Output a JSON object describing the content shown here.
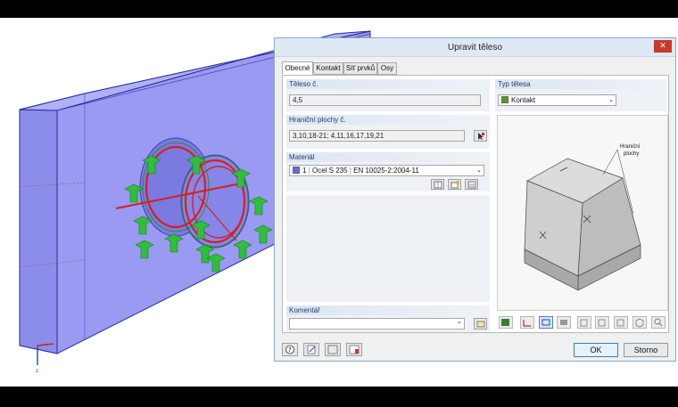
{
  "dialog": {
    "title": "Upravit těleso",
    "close_glyph": "✕"
  },
  "tabs": [
    {
      "label": "Obecné",
      "active": true
    },
    {
      "label": "Kontakt",
      "active": false
    },
    {
      "label": "Síť prvků",
      "active": false
    },
    {
      "label": "Osy",
      "active": false
    }
  ],
  "fields": {
    "body_no_label": "Těleso č.",
    "body_no_value": "4,5",
    "boundary_label": "Hraniční plochy č.",
    "boundary_value": "3,10,18-21; 4,11,16,17,19,21",
    "body_type_label": "Typ tělesa",
    "body_type_value": "Kontakt",
    "body_type_color": "#5a9a1e",
    "material_label": "Materiál",
    "material_number": "1",
    "material_name": "Ocel S 235",
    "material_norm": "EN 10025-2:2004-11",
    "material_color": "#6a6ae0",
    "comment_label": "Komentář",
    "comment_value": ""
  },
  "preview": {
    "annotation_line1": "Hraniční",
    "annotation_line2": "plochy"
  },
  "buttons": {
    "ok": "OK",
    "cancel": "Storno"
  },
  "icons": {
    "combo_arrow": "⌄",
    "axis_label": "z"
  }
}
